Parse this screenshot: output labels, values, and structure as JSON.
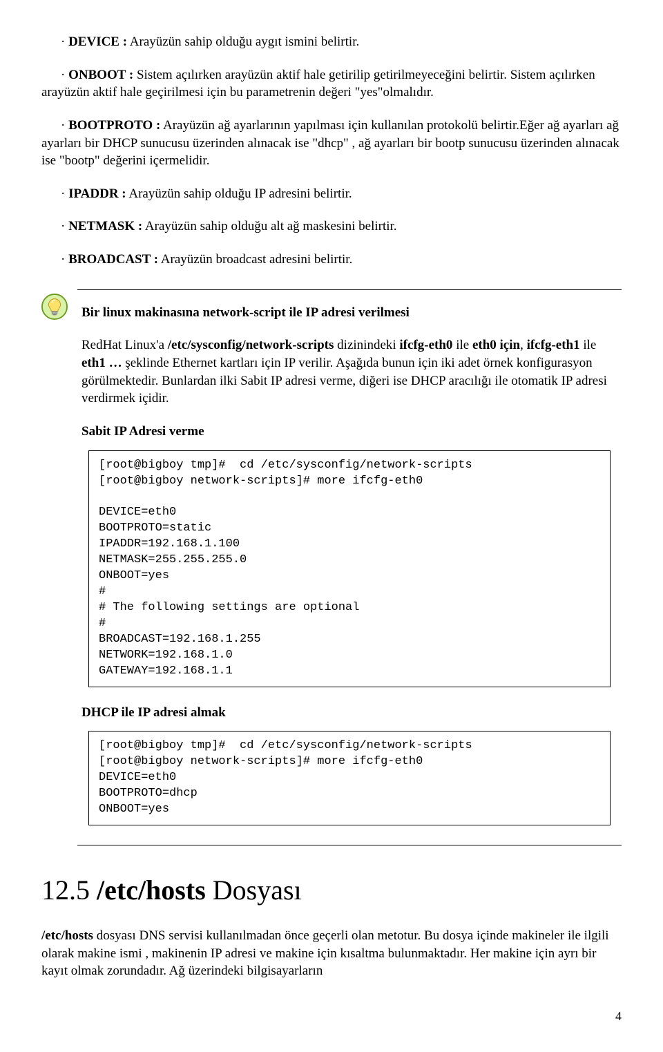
{
  "bullets": {
    "device": {
      "label": "DEVICE :",
      "text": " Arayüzün sahip olduğu aygıt ismini belirtir."
    },
    "onboot": {
      "label": "ONBOOT :",
      "text": " Sistem açılırken arayüzün aktif hale getirilip getirilmeyeceğini belirtir. Sistem açılırken arayüzün aktif hale geçirilmesi için bu parametrenin değeri \"yes\"olmalıdır."
    },
    "bootproto": {
      "label": "BOOTPROTO :",
      "text": " Arayüzün ağ ayarlarının yapılması için kullanılan protokolü belirtir.Eğer ağ ayarları ağ ayarları bir DHCP sunucusu üzerinden alınacak ise \"dhcp\" , ağ ayarları bir bootp sunucusu üzerinden alınacak ise \"bootp\" değerini içermelidir."
    },
    "ipaddr": {
      "label": "IPADDR :",
      "text": " Arayüzün sahip olduğu IP adresini belirtir."
    },
    "netmask": {
      "label": "NETMASK :",
      "text": " Arayüzün sahip olduğu alt ağ maskesini belirtir."
    },
    "broadcast": {
      "label": "BROADCAST :",
      "text": " Arayüzün broadcast adresini belirtir."
    }
  },
  "tip": {
    "title": "Bir linux makinasına network-script ile IP adresi verilmesi",
    "para_prefix": "RedHat Linux'a ",
    "para_path": "/etc/sysconfig/network-scripts",
    "para_mid1": " dizinindeki ",
    "para_if0": "ifcfg-eth0",
    "para_mid2": " ile ",
    "para_eth0": "eth0 için",
    "para_sep": ", ",
    "para_if1": "ifcfg-eth1",
    "para_mid3": " ile ",
    "para_eth1": "eth1 …",
    "para_tail": " şeklinde Ethernet kartları için IP verilir. Aşağıda bunun için iki adet örnek konfigurasyon görülmektedir. Bunlardan ilki Sabit IP adresi verme, diğeri ise DHCP aracılığı ile otomatik IP adresi verdirmek içidir.",
    "sub1": "Sabit IP Adresi verme",
    "code1": "[root@bigboy tmp]#  cd /etc/sysconfig/network-scripts\n[root@bigboy network-scripts]# more ifcfg-eth0\n\nDEVICE=eth0\nBOOTPROTO=static\nIPADDR=192.168.1.100\nNETMASK=255.255.255.0\nONBOOT=yes\n#\n# The following settings are optional\n#\nBROADCAST=192.168.1.255\nNETWORK=192.168.1.0\nGATEWAY=192.168.1.1",
    "sub2": "DHCP ile IP adresi almak",
    "code2": "[root@bigboy tmp]#  cd /etc/sysconfig/network-scripts\n[root@bigboy network-scripts]# more ifcfg-eth0\nDEVICE=eth0\nBOOTPROTO=dhcp\nONBOOT=yes"
  },
  "section": {
    "num": "12.5 ",
    "bold": "/etc/hosts",
    "rest": " Dosyası"
  },
  "final": {
    "p1_b": "/etc/hosts",
    "p1_rest": " dosyası DNS servisi kullanılmadan önce geçerli olan metotur. Bu dosya içinde makineler ile ilgili olarak makine ismi , makinenin IP adresi ve makine için kısaltma bulunmaktadır. Her makine için ayrı bir kayıt olmak zorundadır. Ağ üzerindeki bilgisayarların"
  },
  "page": "4"
}
